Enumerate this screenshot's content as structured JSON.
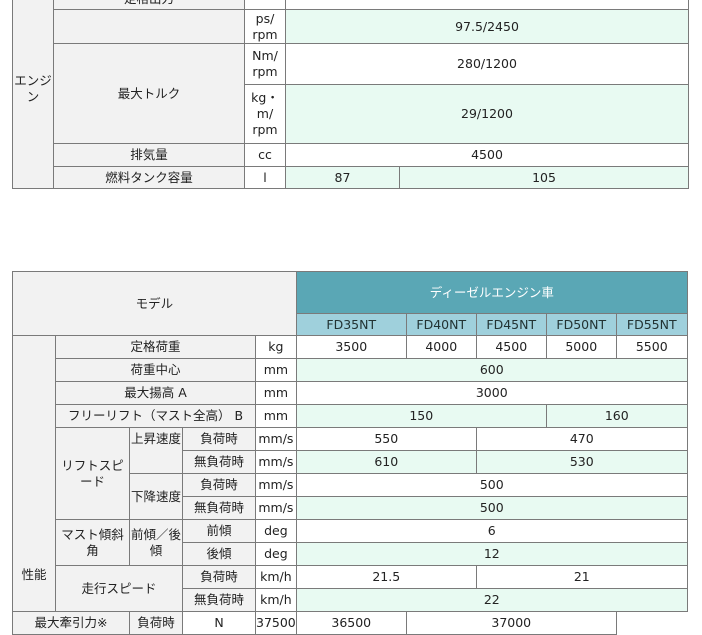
{
  "table1": {
    "engine_label": "エンジ\nン",
    "rated_output_label": "定格出力",
    "rated_output_unit": "ps/\nrpm",
    "rated_output_value": "97.5/2450",
    "max_torque_label": "最大トルク",
    "torque_unit_nm": "Nm/\nrpm",
    "torque_value_nm": "280/1200",
    "torque_unit_kgm": "kg・\nm/\nrpm",
    "torque_value_kgm": "29/1200",
    "displacement_label": "排気量",
    "displacement_unit": "cc",
    "displacement_value": "4500",
    "fuel_tank_label": "燃料タンク容量",
    "fuel_tank_unit": "l",
    "fuel_tank_values": [
      "87",
      "105"
    ]
  },
  "table2": {
    "model_label": "モデル",
    "diesel_label": "ディーゼルエンジン車",
    "models": [
      "FD35NT",
      "FD40NT",
      "FD45NT",
      "FD50NT",
      "FD55NT"
    ],
    "performance_label": "性能",
    "rated_load": {
      "label": "定格荷重",
      "unit": "kg",
      "values": [
        "3500",
        "4000",
        "4500",
        "5000",
        "5500"
      ]
    },
    "load_center": {
      "label": "荷重中心",
      "unit": "mm",
      "value": "600"
    },
    "max_lift": {
      "label": "最大揚高 A",
      "unit": "mm",
      "value": "3000"
    },
    "free_lift": {
      "label": "フリーリフト（マスト全高） B",
      "unit": "mm",
      "values": [
        "150",
        "160"
      ]
    },
    "lift_speed_label": "リフトスピ\nード",
    "lift_up_label": "上昇速度",
    "lift_down_label": "下降速度",
    "loaded_label": "負荷時",
    "unloaded_label": "無負荷時",
    "speed_unit": "mm/s",
    "lift_up_loaded": [
      "550",
      "470"
    ],
    "lift_up_unloaded": [
      "610",
      "530"
    ],
    "lift_down_loaded": "500",
    "lift_down_unloaded": "500",
    "mast_tilt_label": "マスト傾斜\n角",
    "tilt_dir_label": "前傾／後\n傾",
    "forward_label": "前傾",
    "backward_label": "後傾",
    "tilt_unit": "deg",
    "forward_value": "6",
    "backward_value": "12",
    "travel_speed_label": "走行スピード",
    "travel_unit": "km/h",
    "travel_loaded": [
      "21.5",
      "21"
    ],
    "travel_unloaded": "22",
    "drawbar_label": "最大牽引力※",
    "drawbar_loaded_label": "負荷時",
    "drawbar_unit": "N",
    "drawbar_values": [
      "37500",
      "36500",
      "37000"
    ]
  }
}
